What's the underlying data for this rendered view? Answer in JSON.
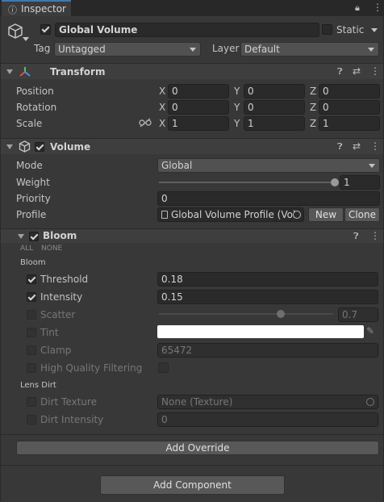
{
  "tab": {
    "label": "Inspector"
  },
  "object": {
    "name": "Global Volume",
    "static_label": "Static",
    "tag_label": "Tag",
    "tag_value": "Untagged",
    "layer_label": "Layer",
    "layer_value": "Default"
  },
  "transform": {
    "title": "Transform",
    "rows": [
      {
        "label": "Position",
        "x": "0",
        "y": "0",
        "z": "0"
      },
      {
        "label": "Rotation",
        "x": "0",
        "y": "0",
        "z": "0"
      },
      {
        "label": "Scale",
        "x": "1",
        "y": "1",
        "z": "1"
      }
    ],
    "axis_x": "X",
    "axis_y": "Y",
    "axis_z": "Z"
  },
  "volume": {
    "title": "Volume",
    "mode_label": "Mode",
    "mode_value": "Global",
    "weight_label": "Weight",
    "weight_value": "1",
    "weight_fraction": 1.0,
    "priority_label": "Priority",
    "priority_value": "0",
    "profile_label": "Profile",
    "profile_value": "Global Volume Profile (Volı",
    "new_label": "New",
    "clone_label": "Clone"
  },
  "bloom": {
    "title": "Bloom",
    "all_label": "ALL",
    "none_label": "NONE",
    "section_bloom": "Bloom",
    "threshold_label": "Threshold",
    "threshold_value": "0.18",
    "intensity_label": "Intensity",
    "intensity_value": "0.15",
    "scatter_label": "Scatter",
    "scatter_value": "0.7",
    "scatter_fraction": 0.7,
    "tint_label": "Tint",
    "clamp_label": "Clamp",
    "clamp_value": "65472",
    "hq_label": "High Quality Filtering",
    "section_lens": "Lens Dirt",
    "dirt_texture_label": "Dirt Texture",
    "dirt_texture_value": "None (Texture)",
    "dirt_intensity_label": "Dirt Intensity",
    "dirt_intensity_value": "0"
  },
  "add_override_label": "Add Override",
  "add_component_label": "Add Component",
  "colors": {
    "tint": "#ffffff",
    "transform_icon": "#e05050"
  }
}
